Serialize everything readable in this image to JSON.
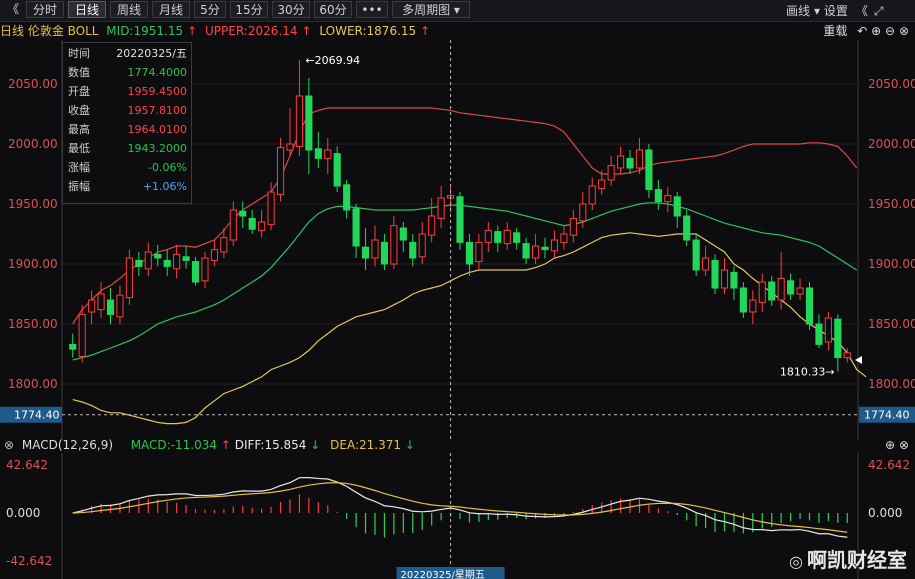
{
  "toolbar": {
    "collapse_left": "《",
    "buttons": [
      "分时",
      "日线",
      "周线",
      "月线",
      "5分",
      "15分",
      "30分",
      "60分",
      "•••",
      "多周期图 ▾"
    ],
    "active_index": 1,
    "draw_label": "画线",
    "settings_label": "▾ 设置",
    "collapse_right": "《",
    "fullscreen_icon": "⤢"
  },
  "info": {
    "title": "日线 伦敦金 BOLL",
    "mid": "MID:1951.15",
    "upper": "UPPER:2026.14",
    "lower": "LOWER:1876.15",
    "mid_arrow": "↑",
    "upper_arrow": "↑",
    "lower_arrow": "↑",
    "right_label": "重载"
  },
  "panel": [
    {
      "k": "时间",
      "v": "20220325/五",
      "c": "#e0e0e0"
    },
    {
      "k": "数值",
      "v": "1774.4000",
      "c": "#22c64c"
    },
    {
      "k": "开盘",
      "v": "1959.4500",
      "c": "#ff4444"
    },
    {
      "k": "收盘",
      "v": "1957.8100",
      "c": "#ff4444"
    },
    {
      "k": "最高",
      "v": "1964.0100",
      "c": "#ff4444"
    },
    {
      "k": "最低",
      "v": "1943.2000",
      "c": "#22c64c"
    },
    {
      "k": "涨幅",
      "v": "-0.06%",
      "c": "#22c64c"
    },
    {
      "k": "振幅",
      "v": "+1.06%",
      "c": "#4aa3ff"
    }
  ],
  "annotations": {
    "high": "2069.94",
    "low": "1810.33",
    "cursor_price": "1774.40",
    "cursor_date": "20220325/星期五"
  },
  "macd": {
    "title": "MACD(12,26,9)",
    "macd": "MACD:-11.034",
    "diff": "DIFF:15.854",
    "dea": "DEA:21.371",
    "macd_arrow": "↑",
    "diff_arrow": "↓",
    "dea_arrow": "↓",
    "axis": [
      "42.642",
      "0.000",
      "-42.642"
    ],
    "axis_right_low": "-42.642"
  },
  "watermark": "啊凯财经室",
  "colors": {
    "up": "#ff3b3b",
    "down": "#22d65a",
    "upper": "#e0473f",
    "mid": "#2bc45a",
    "lower": "#e6c75a",
    "diff": "#e8e8e8",
    "dea": "#e6c040"
  },
  "chart_data": {
    "type": "candlestick",
    "title": "日线 伦敦金 BOLL",
    "y_ticks": [
      1800,
      1850,
      1900,
      1950,
      2000,
      2050
    ],
    "ylim": [
      1755,
      2085
    ],
    "candles": [
      [
        1833,
        1829,
        1842,
        1822
      ],
      [
        1823,
        1858,
        1866,
        1818
      ],
      [
        1860,
        1870,
        1878,
        1850
      ],
      [
        1862,
        1875,
        1885,
        1855
      ],
      [
        1870,
        1858,
        1880,
        1850
      ],
      [
        1856,
        1874,
        1882,
        1850
      ],
      [
        1872,
        1905,
        1912,
        1866
      ],
      [
        1903,
        1898,
        1910,
        1890
      ],
      [
        1896,
        1910,
        1918,
        1890
      ],
      [
        1908,
        1905,
        1916,
        1898
      ],
      [
        1903,
        1898,
        1912,
        1890
      ],
      [
        1896,
        1908,
        1916,
        1888
      ],
      [
        1906,
        1903,
        1915,
        1896
      ],
      [
        1902,
        1885,
        1906,
        1882
      ],
      [
        1886,
        1905,
        1910,
        1880
      ],
      [
        1903,
        1912,
        1920,
        1898
      ],
      [
        1910,
        1922,
        1930,
        1905
      ],
      [
        1920,
        1945,
        1952,
        1915
      ],
      [
        1944,
        1940,
        1952,
        1930
      ],
      [
        1938,
        1929,
        1945,
        1925
      ],
      [
        1928,
        1935,
        1945,
        1922
      ],
      [
        1933,
        1960,
        1968,
        1928
      ],
      [
        1958,
        1997,
        2005,
        1952
      ],
      [
        1995,
        2000,
        2030,
        1990
      ],
      [
        1998,
        2040,
        2069.94,
        1990
      ],
      [
        2040,
        1995,
        2055,
        1975
      ],
      [
        1996,
        1988,
        2010,
        1980
      ],
      [
        1988,
        1995,
        2005,
        1975
      ],
      [
        1992,
        1965,
        1998,
        1960
      ],
      [
        1966,
        1945,
        1970,
        1938
      ],
      [
        1946,
        1915,
        1950,
        1905
      ],
      [
        1914,
        1905,
        1930,
        1895
      ],
      [
        1905,
        1920,
        1932,
        1898
      ],
      [
        1918,
        1900,
        1925,
        1895
      ],
      [
        1900,
        1932,
        1940,
        1896
      ],
      [
        1930,
        1920,
        1935,
        1910
      ],
      [
        1918,
        1905,
        1925,
        1898
      ],
      [
        1906,
        1925,
        1935,
        1900
      ],
      [
        1924,
        1940,
        1955,
        1918
      ],
      [
        1938,
        1955,
        1965,
        1930
      ],
      [
        1955,
        1957,
        1964,
        1943
      ],
      [
        1956,
        1918,
        1960,
        1912
      ],
      [
        1918,
        1900,
        1925,
        1890
      ],
      [
        1902,
        1918,
        1925,
        1895
      ],
      [
        1918,
        1928,
        1935,
        1910
      ],
      [
        1927,
        1918,
        1932,
        1910
      ],
      [
        1917,
        1928,
        1935,
        1912
      ],
      [
        1926,
        1918,
        1930,
        1912
      ],
      [
        1917,
        1905,
        1922,
        1900
      ],
      [
        1905,
        1915,
        1925,
        1900
      ],
      [
        1914,
        1912,
        1922,
        1905
      ],
      [
        1911,
        1920,
        1928,
        1905
      ],
      [
        1918,
        1925,
        1932,
        1912
      ],
      [
        1924,
        1938,
        1945,
        1918
      ],
      [
        1936,
        1950,
        1960,
        1930
      ],
      [
        1950,
        1965,
        1972,
        1945
      ],
      [
        1963,
        1970,
        1978,
        1958
      ],
      [
        1970,
        1982,
        1990,
        1965
      ],
      [
        1980,
        1990,
        1998,
        1975
      ],
      [
        1988,
        1980,
        1995,
        1975
      ],
      [
        1980,
        1995,
        2005,
        1975
      ],
      [
        1995,
        1962,
        2000,
        1955
      ],
      [
        1962,
        1952,
        1970,
        1945
      ],
      [
        1952,
        1957,
        1964,
        1943
      ],
      [
        1956,
        1940,
        1960,
        1930
      ],
      [
        1940,
        1920,
        1945,
        1915
      ],
      [
        1920,
        1895,
        1925,
        1890
      ],
      [
        1895,
        1905,
        1915,
        1890
      ],
      [
        1903,
        1880,
        1908,
        1875
      ],
      [
        1880,
        1895,
        1905,
        1875
      ],
      [
        1893,
        1880,
        1898,
        1870
      ],
      [
        1880,
        1860,
        1885,
        1855
      ],
      [
        1860,
        1870,
        1878,
        1850
      ],
      [
        1868,
        1885,
        1892,
        1860
      ],
      [
        1885,
        1870,
        1890,
        1865
      ],
      [
        1870,
        1888,
        1910,
        1862
      ],
      [
        1886,
        1875,
        1892,
        1870
      ],
      [
        1875,
        1880,
        1888,
        1870
      ],
      [
        1880,
        1850,
        1885,
        1845
      ],
      [
        1850,
        1833,
        1858,
        1830
      ],
      [
        1835,
        1855,
        1860,
        1828
      ],
      [
        1854,
        1822,
        1858,
        1810.33
      ],
      [
        1822,
        1826,
        1830,
        1818
      ]
    ],
    "upper": [
      1850,
      1862,
      1870,
      1878,
      1882,
      1888,
      1895,
      1900,
      1905,
      1910,
      1912,
      1915,
      1915,
      1914,
      1917,
      1920,
      1928,
      1938,
      1945,
      1950,
      1955,
      1960,
      1972,
      1990,
      2010,
      2025,
      2028,
      2030,
      2030,
      2030,
      2030,
      2030,
      2030,
      2030,
      2030,
      2030,
      2030,
      2030,
      2030,
      2029,
      2028,
      2026,
      2025,
      2024,
      2023,
      2022,
      2021,
      2020,
      2019,
      2018,
      2017,
      2015,
      2010,
      2000,
      1990,
      1980,
      1975,
      1975,
      1975,
      1976,
      1978,
      1982,
      1984,
      1985,
      1986,
      1987,
      1988,
      1989,
      1990,
      1992,
      1995,
      1998,
      2000,
      2000,
      2000,
      2000,
      2000,
      2000,
      2001,
      2001,
      2000,
      1998,
      1990,
      1980
    ],
    "mid": [
      1820,
      1822,
      1824,
      1827,
      1830,
      1833,
      1836,
      1840,
      1845,
      1850,
      1853,
      1856,
      1858,
      1860,
      1863,
      1866,
      1870,
      1875,
      1880,
      1885,
      1890,
      1897,
      1906,
      1915,
      1925,
      1935,
      1942,
      1946,
      1948,
      1948,
      1947,
      1946,
      1945,
      1945,
      1945,
      1945,
      1945,
      1946,
      1947,
      1948,
      1949,
      1949,
      1948,
      1947,
      1946,
      1945,
      1944,
      1942,
      1940,
      1938,
      1936,
      1934,
      1932,
      1933,
      1935,
      1938,
      1941,
      1944,
      1946,
      1948,
      1950,
      1951,
      1951,
      1950,
      1948,
      1946,
      1943,
      1940,
      1937,
      1934,
      1932,
      1930,
      1928,
      1926,
      1925,
      1924,
      1922,
      1920,
      1918,
      1915,
      1910,
      1905,
      1900,
      1895
    ],
    "lower": [
      1787,
      1785,
      1782,
      1778,
      1776,
      1776,
      1774,
      1772,
      1770,
      1768,
      1767,
      1767,
      1768,
      1772,
      1780,
      1786,
      1792,
      1795,
      1798,
      1802,
      1806,
      1812,
      1815,
      1818,
      1822,
      1828,
      1836,
      1842,
      1848,
      1852,
      1856,
      1858,
      1860,
      1862,
      1866,
      1870,
      1875,
      1878,
      1880,
      1882,
      1886,
      1890,
      1893,
      1895,
      1895,
      1895,
      1895,
      1895,
      1895,
      1897,
      1900,
      1905,
      1907,
      1910,
      1914,
      1918,
      1922,
      1924,
      1925,
      1926,
      1925,
      1924,
      1923,
      1924,
      1925,
      1925,
      1925,
      1920,
      1915,
      1910,
      1900,
      1895,
      1888,
      1882,
      1876,
      1870,
      1864,
      1856,
      1850,
      1845,
      1840,
      1835,
      1826,
      1812,
      1806
    ]
  }
}
